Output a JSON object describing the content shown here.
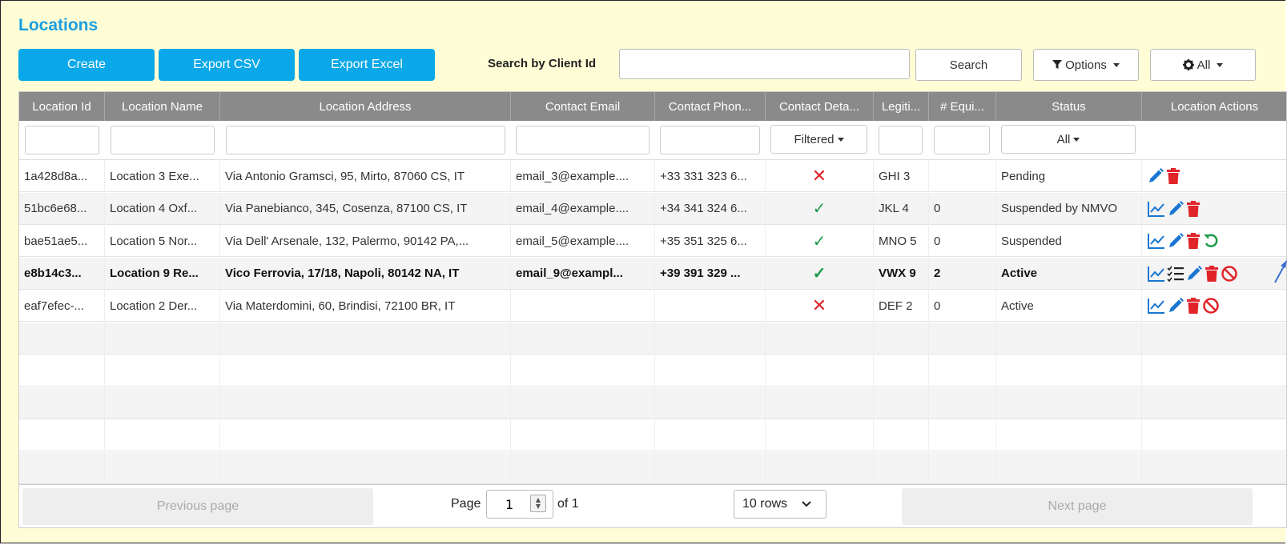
{
  "page": {
    "title": "Locations"
  },
  "toolbar": {
    "create_label": "Create",
    "export_csv_label": "Export CSV",
    "export_excel_label": "Export Excel",
    "search_label": "Search by Client Id",
    "search_value": "",
    "search_button_label": "Search",
    "options_label": "Options",
    "all_label": "All"
  },
  "columns": [
    "Location Id",
    "Location Name",
    "Location Address",
    "Contact Email",
    "Contact Phon...",
    "Contact Deta...",
    "Legiti...",
    "# Equi...",
    "Status",
    "Location Actions"
  ],
  "filters": {
    "contact_details_label": "Filtered",
    "status_label": "All"
  },
  "rows": [
    {
      "id": "1a428d8a...",
      "name": "Location 3 Exe...",
      "address": "Via Antonio Gramsci, 95, Mirto, 87060 CS, IT",
      "email": "email_3@example....",
      "phone": "+33 331 323 6...",
      "contact_ok": false,
      "legit": "GHI 3",
      "equip": "",
      "status": "Pending",
      "actions": [
        "edit-icon",
        "delete-icon"
      ],
      "bold": false
    },
    {
      "id": "51bc6e68...",
      "name": "Location 4 Oxf...",
      "address": "Via Panebianco, 345, Cosenza, 87100 CS, IT",
      "email": "email_4@example....",
      "phone": "+34 341 324 6...",
      "contact_ok": true,
      "legit": "JKL 4",
      "equip": "0",
      "status": "Suspended by NMVO",
      "actions": [
        "chart-icon",
        "edit-icon",
        "delete-icon"
      ],
      "bold": false
    },
    {
      "id": "bae51ae5...",
      "name": "Location 5 Nor...",
      "address": "Via Dell' Arsenale, 132, Palermo, 90142 PA,...",
      "email": "email_5@example....",
      "phone": "+35 351 325 6...",
      "contact_ok": true,
      "legit": "MNO 5",
      "equip": "0",
      "status": "Suspended",
      "actions": [
        "chart-icon",
        "edit-icon",
        "delete-icon",
        "restore-icon"
      ],
      "bold": false
    },
    {
      "id": "e8b14c3...",
      "name": "Location 9 Re...",
      "address": "Vico Ferrovia, 17/18, Napoli, 80142 NA, IT",
      "email": "email_9@exampl...",
      "phone": "+39 391 329 ...",
      "contact_ok": true,
      "legit": "VWX 9",
      "equip": "2",
      "status": "Active",
      "actions": [
        "chart-icon",
        "checklist-icon",
        "edit-icon",
        "delete-icon",
        "block-icon"
      ],
      "bold": true
    },
    {
      "id": "eaf7efec-...",
      "name": "Location 2 Der...",
      "address": "Via Materdomini, 60, Brindisi, 72100 BR, IT",
      "email": "",
      "phone": "",
      "contact_ok": false,
      "legit": "DEF 2",
      "equip": "0",
      "status": "Active",
      "actions": [
        "chart-icon",
        "edit-icon",
        "delete-icon",
        "block-icon"
      ],
      "bold": false
    }
  ],
  "pagination": {
    "prev_label": "Previous page",
    "page_label": "Page",
    "page_value": "1",
    "of_label": "of 1",
    "rows_label": "10 rows",
    "next_label": "Next page"
  },
  "colors": {
    "accent": "#0aa8e8",
    "title": "#1a9fe0",
    "danger": "#e0242a",
    "success": "#1e9a4a",
    "icon_blue": "#1976d2"
  }
}
